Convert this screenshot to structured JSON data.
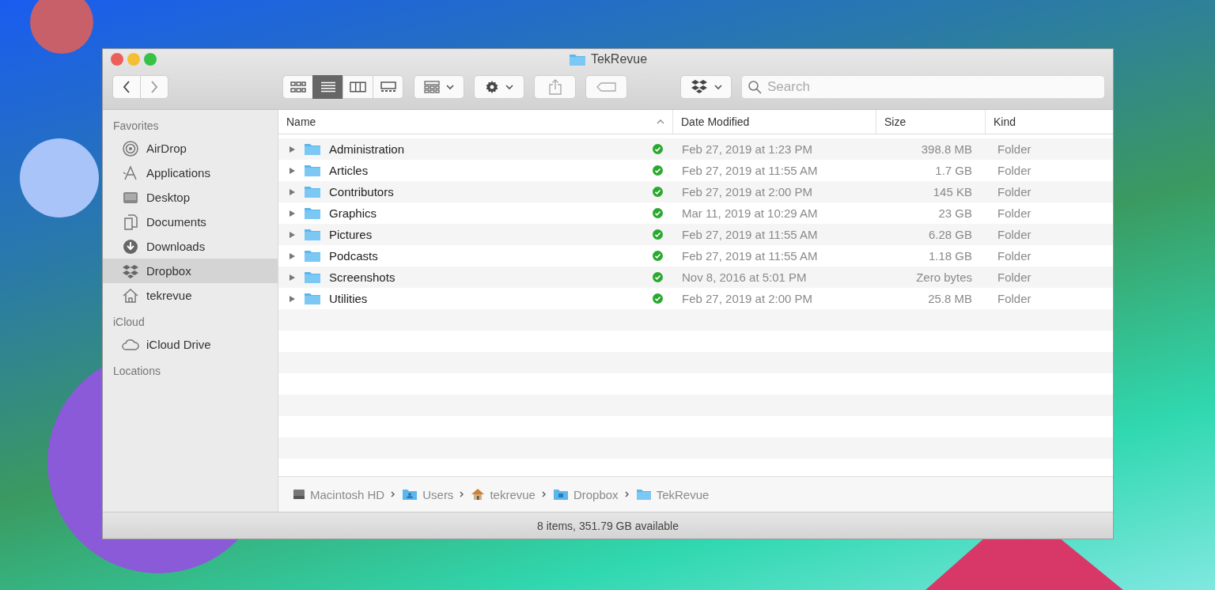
{
  "window": {
    "title": "TekRevue"
  },
  "toolbar": {
    "view_modes": [
      {
        "kind": "icons",
        "selected": false
      },
      {
        "kind": "list",
        "selected": true
      },
      {
        "kind": "columns",
        "selected": false
      },
      {
        "kind": "gallery",
        "selected": false
      }
    ],
    "search": {
      "placeholder": "Search"
    }
  },
  "sidebar": {
    "sections": [
      {
        "heading": "Favorites",
        "items": [
          {
            "label": "AirDrop",
            "kind": "airdrop",
            "selected": false
          },
          {
            "label": "Applications",
            "kind": "applications",
            "selected": false
          },
          {
            "label": "Desktop",
            "kind": "desktop",
            "selected": false
          },
          {
            "label": "Documents",
            "kind": "documents",
            "selected": false
          },
          {
            "label": "Downloads",
            "kind": "downloads",
            "selected": false
          },
          {
            "label": "Dropbox",
            "kind": "dropbox",
            "selected": true
          },
          {
            "label": "tekrevue",
            "kind": "home",
            "selected": false
          }
        ]
      },
      {
        "heading": "iCloud",
        "items": [
          {
            "label": "iCloud Drive",
            "kind": "cloud",
            "selected": false
          }
        ]
      },
      {
        "heading": "Locations"
      }
    ]
  },
  "table": {
    "columns": [
      {
        "label": "Name",
        "sorted": true
      },
      {
        "label": "Date Modified",
        "sorted": false
      },
      {
        "label": "Size",
        "sorted": false
      },
      {
        "label": "Kind",
        "sorted": false
      }
    ],
    "rows": [
      {
        "name": "Administration",
        "expanded": false,
        "synced": true,
        "date": "Feb 27, 2019 at 1:23 PM",
        "size": "398.8 MB",
        "kind": "Folder"
      },
      {
        "name": "Articles",
        "expanded": false,
        "synced": true,
        "date": "Feb 27, 2019 at 11:55 AM",
        "size": "1.7 GB",
        "kind": "Folder"
      },
      {
        "name": "Contributors",
        "expanded": false,
        "synced": true,
        "date": "Feb 27, 2019 at 2:00 PM",
        "size": "145 KB",
        "kind": "Folder"
      },
      {
        "name": "Graphics",
        "expanded": false,
        "synced": true,
        "date": "Mar 11, 2019 at 10:29 AM",
        "size": "23 GB",
        "kind": "Folder"
      },
      {
        "name": "Pictures",
        "expanded": false,
        "synced": true,
        "date": "Feb 27, 2019 at 11:55 AM",
        "size": "6.28 GB",
        "kind": "Folder"
      },
      {
        "name": "Podcasts",
        "expanded": false,
        "synced": true,
        "date": "Feb 27, 2019 at 11:55 AM",
        "size": "1.18 GB",
        "kind": "Folder"
      },
      {
        "name": "Screenshots",
        "expanded": false,
        "synced": true,
        "date": "Nov 8, 2016 at 5:01 PM",
        "size": "Zero bytes",
        "kind": "Folder"
      },
      {
        "name": "Utilities",
        "expanded": false,
        "synced": true,
        "date": "Feb 27, 2019 at 2:00 PM",
        "size": "25.8 MB",
        "kind": "Folder"
      }
    ]
  },
  "path_bar": [
    {
      "label": "Macintosh HD",
      "kind": "disk"
    },
    {
      "label": "Users",
      "kind": "users"
    },
    {
      "label": "tekrevue",
      "kind": "home"
    },
    {
      "label": "Dropbox",
      "kind": "dropbox-folder"
    },
    {
      "label": "TekRevue",
      "kind": "folder"
    }
  ],
  "status_bar": "8 items, 351.79 GB available"
}
